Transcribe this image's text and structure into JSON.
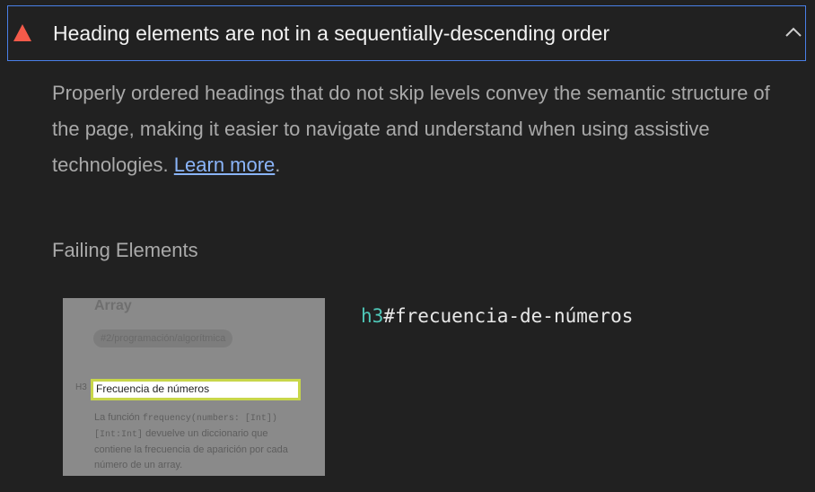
{
  "audit": {
    "title": "Heading elements are not in a sequentially-descending order",
    "icon": "warning-triangle-icon",
    "status_color": "#f35a4a",
    "expanded": true,
    "description": "Properly ordered headings that do not skip levels convey the semantic structure of the page, making it easier to navigate and understand when using assistive technologies.",
    "learn_more_label": "Learn more",
    "after_link": "."
  },
  "failing": {
    "section_title": "Failing Elements",
    "items": [
      {
        "selector_tag": "h3",
        "selector_id": "#frecuencia-de-números",
        "thumbnail": {
          "heading_above": "Array",
          "tag": "#2/programación/algorítmica",
          "level_label": "H3",
          "highlighted_text": "Frecuencia de números",
          "body_before": "La función",
          "body_code1": "frequency(numbers: [Int])",
          "body_code2": "[Int:Int]",
          "body_after": "devuelve un diccionario que contiene la frecuencia de aparición por cada número de un array."
        }
      }
    ]
  }
}
